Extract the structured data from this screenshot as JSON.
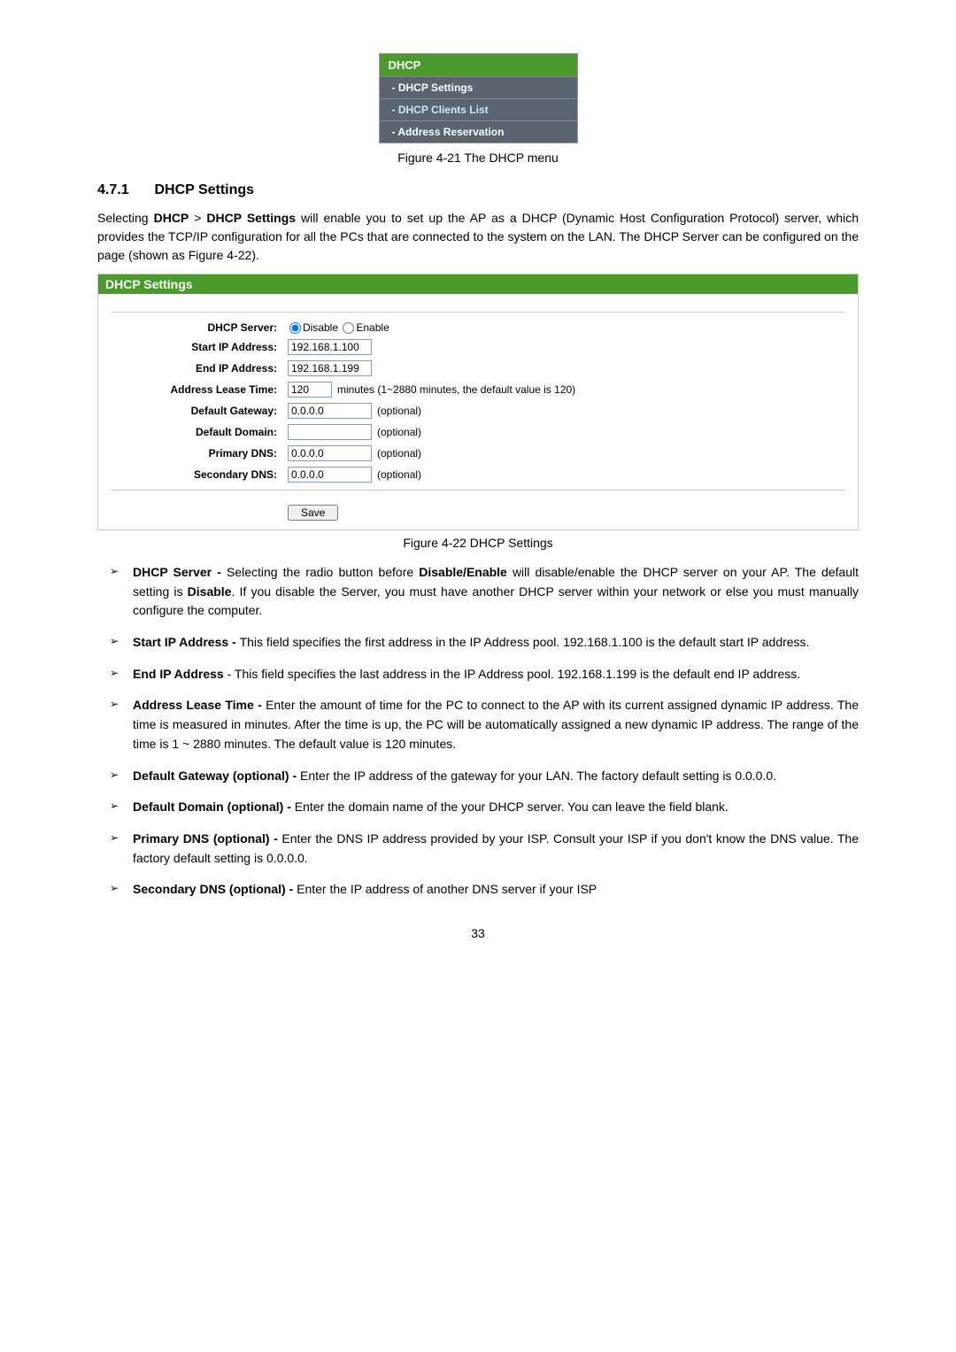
{
  "menu": {
    "header": "DHCP",
    "items": [
      "- DHCP Settings",
      "- DHCP Clients List",
      "- Address Reservation"
    ]
  },
  "figure1_caption": "Figure 4-21 The DHCP menu",
  "section": {
    "num": "4.7.1",
    "title": "DHCP Settings"
  },
  "intro_parts": {
    "p0": "Selecting ",
    "p1": "DHCP",
    "p2": " > ",
    "p3": "DHCP Settings",
    "p4": " will enable you to set up the AP as a DHCP (Dynamic Host Configuration Protocol) server, which provides the TCP/IP configuration for all the PCs that are connected to the system on the LAN. The DHCP Server can be configured on the page (shown as Figure 4-22)."
  },
  "form": {
    "title": "DHCP Settings",
    "dhcp_server_label": "DHCP Server:",
    "disable_label": "Disable",
    "enable_label": "Enable",
    "start_ip_label": "Start IP Address:",
    "start_ip_value": "192.168.1.100",
    "end_ip_label": "End IP Address:",
    "end_ip_value": "192.168.1.199",
    "lease_label": "Address Lease Time:",
    "lease_value": "120",
    "lease_hint": "minutes (1~2880 minutes, the default value is 120)",
    "gateway_label": "Default Gateway:",
    "gateway_value": "0.0.0.0",
    "domain_label": "Default Domain:",
    "domain_value": "",
    "pdns_label": "Primary DNS:",
    "pdns_value": "0.0.0.0",
    "sdns_label": "Secondary DNS:",
    "sdns_value": "0.0.0.0",
    "optional": "(optional)",
    "save": "Save"
  },
  "figure2_caption": "Figure 4-22 DHCP Settings",
  "bullets": {
    "b0_t": "DHCP Server - ",
    "b0_a": "Selecting the radio button before ",
    "b0_b": "Disable/Enable",
    "b0_c": " will disable/enable the DHCP server on your AP. The default setting is ",
    "b0_d": "Disable",
    "b0_e": ". If you disable the Server, you must have another DHCP server within your network or else you must manually configure the computer.",
    "b1_t": "Start IP Address - ",
    "b1_a": "This field specifies the first address in the IP Address pool. 192.168.1.100 is the default start IP address.",
    "b2_t": "End IP Address",
    "b2_a": " - This field specifies the last address in the IP Address pool. 192.168.1.199 is the default end IP address.",
    "b3_t": "Address Lease Time - ",
    "b3_a": "Enter the amount of time for the PC to connect to the AP with its current assigned dynamic IP address. The time is measured in minutes. After the time is up, the PC will be automatically assigned a new dynamic IP address. The range of the time is 1 ~ 2880 minutes. The default value is 120 minutes.",
    "b4_t": "Default Gateway (optional) - ",
    "b4_a": "Enter the IP address of the gateway for your LAN. The factory default setting is 0.0.0.0.",
    "b5_t": "Default Domain (optional) - ",
    "b5_a": "Enter the domain name of the your DHCP server. You can leave the field blank.",
    "b6_t": "Primary DNS (optional) - ",
    "b6_a": "Enter the DNS IP address provided by your ISP. Consult your ISP if you don't know the DNS value. The factory default setting is 0.0.0.0.",
    "b7_t": "Secondary DNS (optional) - ",
    "b7_a": "Enter the IP address of another DNS server if your ISP"
  },
  "page_number": "33"
}
